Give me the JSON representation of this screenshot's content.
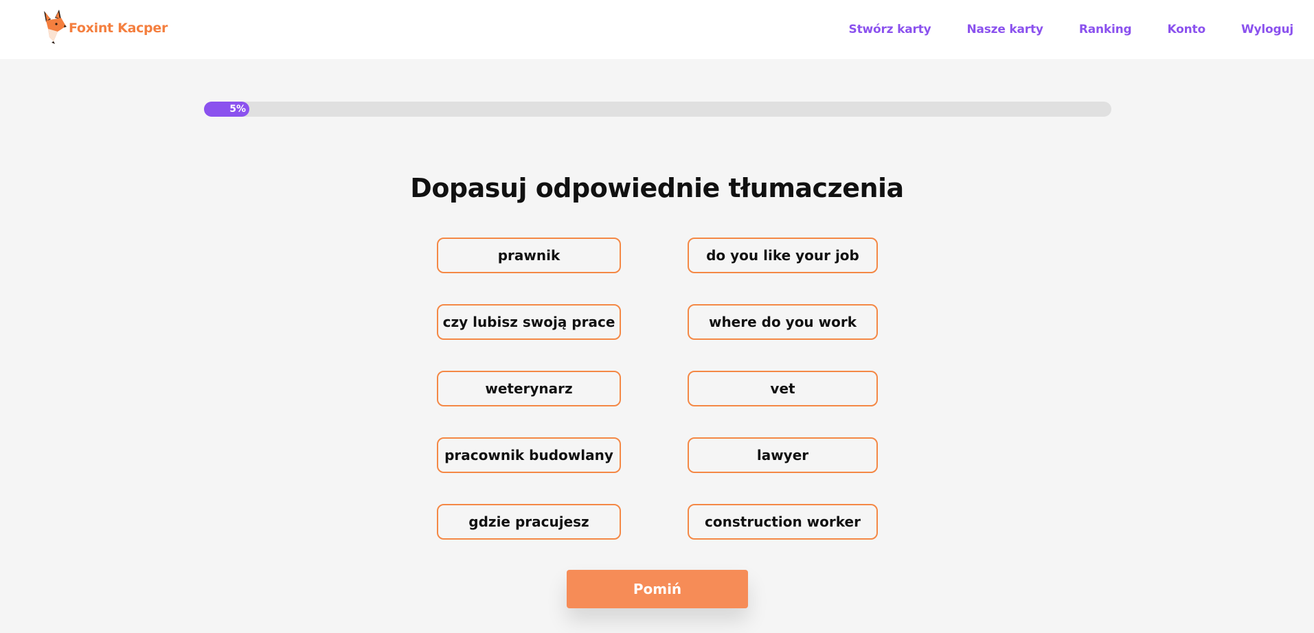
{
  "brand": {
    "name": "Foxint Kacper",
    "color": "#f47f3f"
  },
  "nav": {
    "items": [
      {
        "label": "Stwórz karty"
      },
      {
        "label": "Nasze karty"
      },
      {
        "label": "Ranking"
      },
      {
        "label": "Konto"
      },
      {
        "label": "Wyloguj"
      }
    ],
    "color": "#8b52ee"
  },
  "progress": {
    "percent": 5,
    "label": "5%"
  },
  "game": {
    "title": "Dopasuj odpowiednie tłumaczenia",
    "left_tiles": [
      {
        "text": "prawnik"
      },
      {
        "text": "czy lubisz swoją prace"
      },
      {
        "text": "weterynarz"
      },
      {
        "text": "pracownik budowlany"
      },
      {
        "text": "gdzie pracujesz"
      }
    ],
    "right_tiles": [
      {
        "text": "do you like your job"
      },
      {
        "text": "where do you work"
      },
      {
        "text": "vet"
      },
      {
        "text": "lawyer"
      },
      {
        "text": "construction worker"
      }
    ],
    "skip_label": "Pomiń"
  },
  "colors": {
    "accent_purple": "#8b52ee",
    "accent_orange": "#f68c57",
    "tile_border": "#f48845",
    "background": "#f5f5f5"
  }
}
